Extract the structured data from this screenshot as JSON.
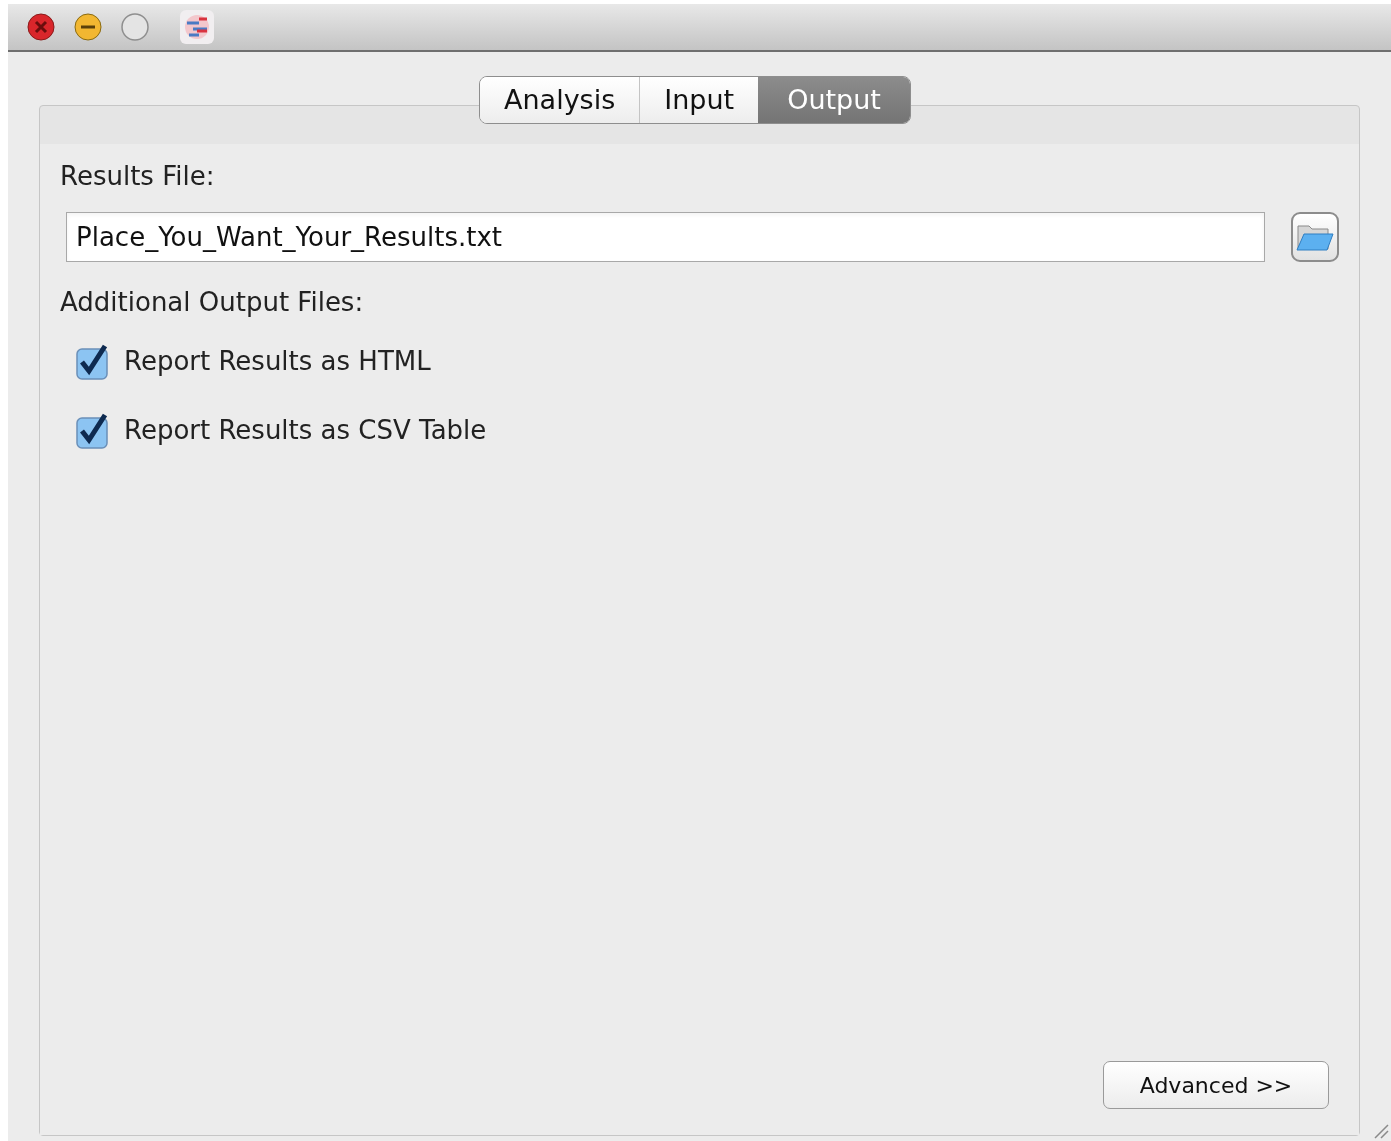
{
  "tabs": [
    {
      "label": "Analysis",
      "selected": false
    },
    {
      "label": "Input",
      "selected": false
    },
    {
      "label": "Output",
      "selected": true
    }
  ],
  "results_file": {
    "label": "Results File:",
    "value": "Place_You_Want_Your_Results.txt"
  },
  "additional_output": {
    "label": "Additional Output Files:",
    "options": [
      {
        "label": "Report Results as HTML",
        "checked": true
      },
      {
        "label": "Report Results as CSV Table",
        "checked": true
      }
    ]
  },
  "advanced_button": "Advanced >>"
}
